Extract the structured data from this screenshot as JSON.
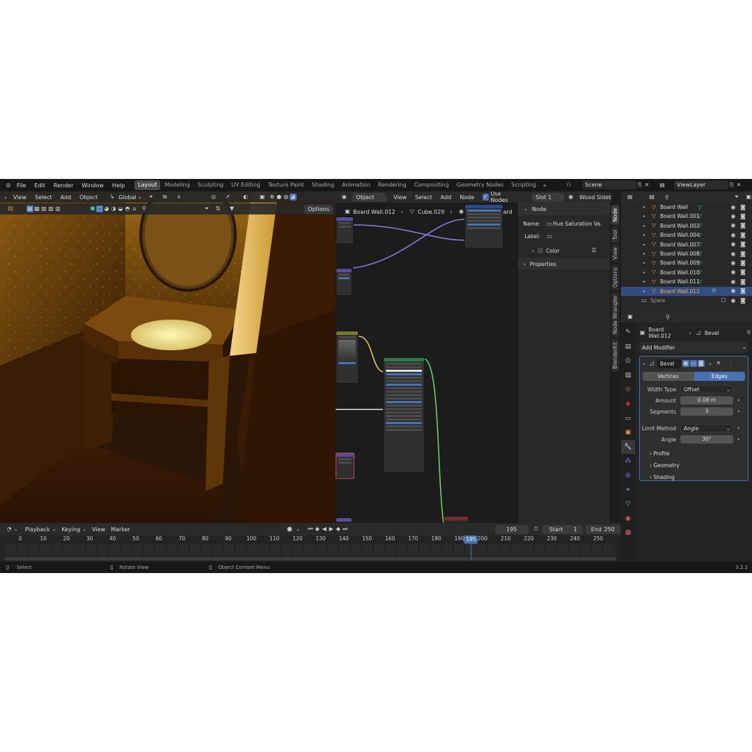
{
  "menubar": {
    "items": [
      "File",
      "Edit",
      "Render",
      "Window",
      "Help"
    ],
    "workspaces": [
      "Layout",
      "Modeling",
      "Sculpting",
      "UV Editing",
      "Texture Paint",
      "Shading",
      "Animation",
      "Rendering",
      "Compositing",
      "Geometry Nodes",
      "Scripting"
    ],
    "active_workspace": "Layout",
    "add_tab": "+",
    "scene": "Scene",
    "view_layer": "ViewLayer"
  },
  "viewport": {
    "menu": [
      "View",
      "Select",
      "Add",
      "Object"
    ],
    "orientation": "Global",
    "options_label": "Options"
  },
  "node_editor": {
    "mode": "Object",
    "menu": [
      "View",
      "Select",
      "Add",
      "Node"
    ],
    "use_nodes_label": "Use Nodes",
    "slot": "Slot 1",
    "material": "Wood Sideboard",
    "breadcrumb": [
      "Board Wall.012",
      "Cube.029",
      "Wood Sideboard"
    ],
    "sidebar_tabs": [
      "Node",
      "Tool",
      "View",
      "Options",
      "Node Wrangler",
      "BlenderKit"
    ],
    "panel": {
      "title": "Node",
      "name_label": "Name:",
      "name_value": "Hue Saturation Va...",
      "label_label": "Label:",
      "label_value": "",
      "color_label": "Color",
      "properties_label": "Properties"
    }
  },
  "outliner": {
    "rows": [
      {
        "name": "Board Wall",
        "selected": false
      },
      {
        "name": "Board Wall.001",
        "selected": false
      },
      {
        "name": "Board Wall.002",
        "selected": false
      },
      {
        "name": "Board Wall.004",
        "selected": false
      },
      {
        "name": "Board Wall.007",
        "selected": false
      },
      {
        "name": "Board Wall.008",
        "selected": false
      },
      {
        "name": "Board Wall.009",
        "selected": false
      },
      {
        "name": "Board Wall.010",
        "selected": false
      },
      {
        "name": "Board Wall.011",
        "selected": false
      },
      {
        "name": "Board Wall.012",
        "selected": true
      }
    ],
    "collection": "Spare"
  },
  "properties": {
    "object": "Board Wall.012",
    "modifier_breadcrumb": "Bevel",
    "add_modifier": "Add Modifier",
    "modifier_name": "Bevel",
    "affect_tabs": [
      "Vertices",
      "Edges"
    ],
    "affect_active": "Edges",
    "width_type_label": "Width Type",
    "width_type": "Offset",
    "amount_label": "Amount",
    "amount": "0.08 m",
    "segments_label": "Segments",
    "segments": "3",
    "limit_method_label": "Limit Method",
    "limit_method": "Angle",
    "angle_label": "Angle",
    "angle": "30°",
    "subpanels": [
      "Profile",
      "Geometry",
      "Shading"
    ]
  },
  "timeline": {
    "menu": [
      "Playback",
      "Keying",
      "View",
      "Marker"
    ],
    "current_frame": "195",
    "start_label": "Start",
    "start": "1",
    "end_label": "End",
    "end": "250",
    "ticks": [
      "0",
      "10",
      "20",
      "30",
      "40",
      "50",
      "60",
      "70",
      "80",
      "90",
      "100",
      "110",
      "120",
      "130",
      "140",
      "150",
      "160",
      "170",
      "180",
      "190",
      "200",
      "210",
      "220",
      "230",
      "240",
      "250"
    ],
    "playhead_label": "195",
    "playhead_frame": 195
  },
  "statusbar": {
    "select": "Select",
    "rotate": "Rotate View",
    "context": "Object Context Menu",
    "version": "3.2.2"
  },
  "colors": {
    "accent": "#4772b3",
    "selected_text": "#ffa95c",
    "mesh_icon": "#e8944b",
    "vertex_icon": "#3ec49b"
  }
}
